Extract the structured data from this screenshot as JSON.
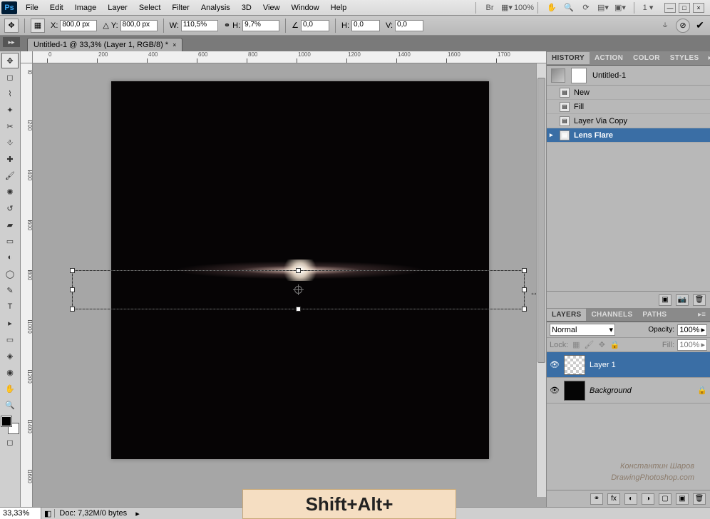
{
  "menu": {
    "items": [
      "File",
      "Edit",
      "Image",
      "Layer",
      "Select",
      "Filter",
      "Analysis",
      "3D",
      "View",
      "Window",
      "Help"
    ]
  },
  "top_controls": {
    "zoom_pct": "100%",
    "workspace": "1"
  },
  "options": {
    "x_label": "X:",
    "x": "800,0 px",
    "y_label": "Y:",
    "y": "800,0 px",
    "w_label": "W:",
    "w": "110,5%",
    "h_label": "H:",
    "h": "9,7%",
    "angle_label": "∠",
    "angle": "0,0",
    "hskew_label": "H:",
    "hskew": "0,0",
    "vskew_label": "V:",
    "vskew": "0,0"
  },
  "doc": {
    "tab_title": "Untitled-1 @ 33,3% (Layer 1, RGB/8) *",
    "history_name": "Untitled-1"
  },
  "ruler_h": [
    "0",
    "200",
    "400",
    "600",
    "800",
    "1000",
    "1200",
    "1400",
    "1600",
    "1700"
  ],
  "ruler_v": [
    "0",
    "200",
    "400",
    "600",
    "800",
    "1000",
    "1200",
    "1400",
    "1600"
  ],
  "history": {
    "tabs": [
      "HISTORY",
      "ACTION",
      "COLOR",
      "STYLES"
    ],
    "items": [
      {
        "label": "New"
      },
      {
        "label": "Fill"
      },
      {
        "label": "Layer Via Copy"
      },
      {
        "label": "Lens Flare",
        "selected": true
      }
    ]
  },
  "layers": {
    "tabs": [
      "LAYERS",
      "CHANNELS",
      "PATHS"
    ],
    "blend_mode": "Normal",
    "opacity_label": "Opacity:",
    "opacity": "100%",
    "lock_label": "Lock:",
    "fill_label": "Fill:",
    "fill": "100%",
    "items": [
      {
        "name": "Layer 1",
        "selected": true,
        "thumb": "checker"
      },
      {
        "name": "Background",
        "locked": true,
        "thumb": "black",
        "italic": true
      }
    ]
  },
  "status": {
    "zoom": "33,33%",
    "doc_info": "Doc: 7,32M/0 bytes"
  },
  "watermark": {
    "line1": "Константин Шаров",
    "line2": "DrawingPhotoshop.com"
  },
  "overlay": {
    "text": "Shift+Alt+"
  }
}
